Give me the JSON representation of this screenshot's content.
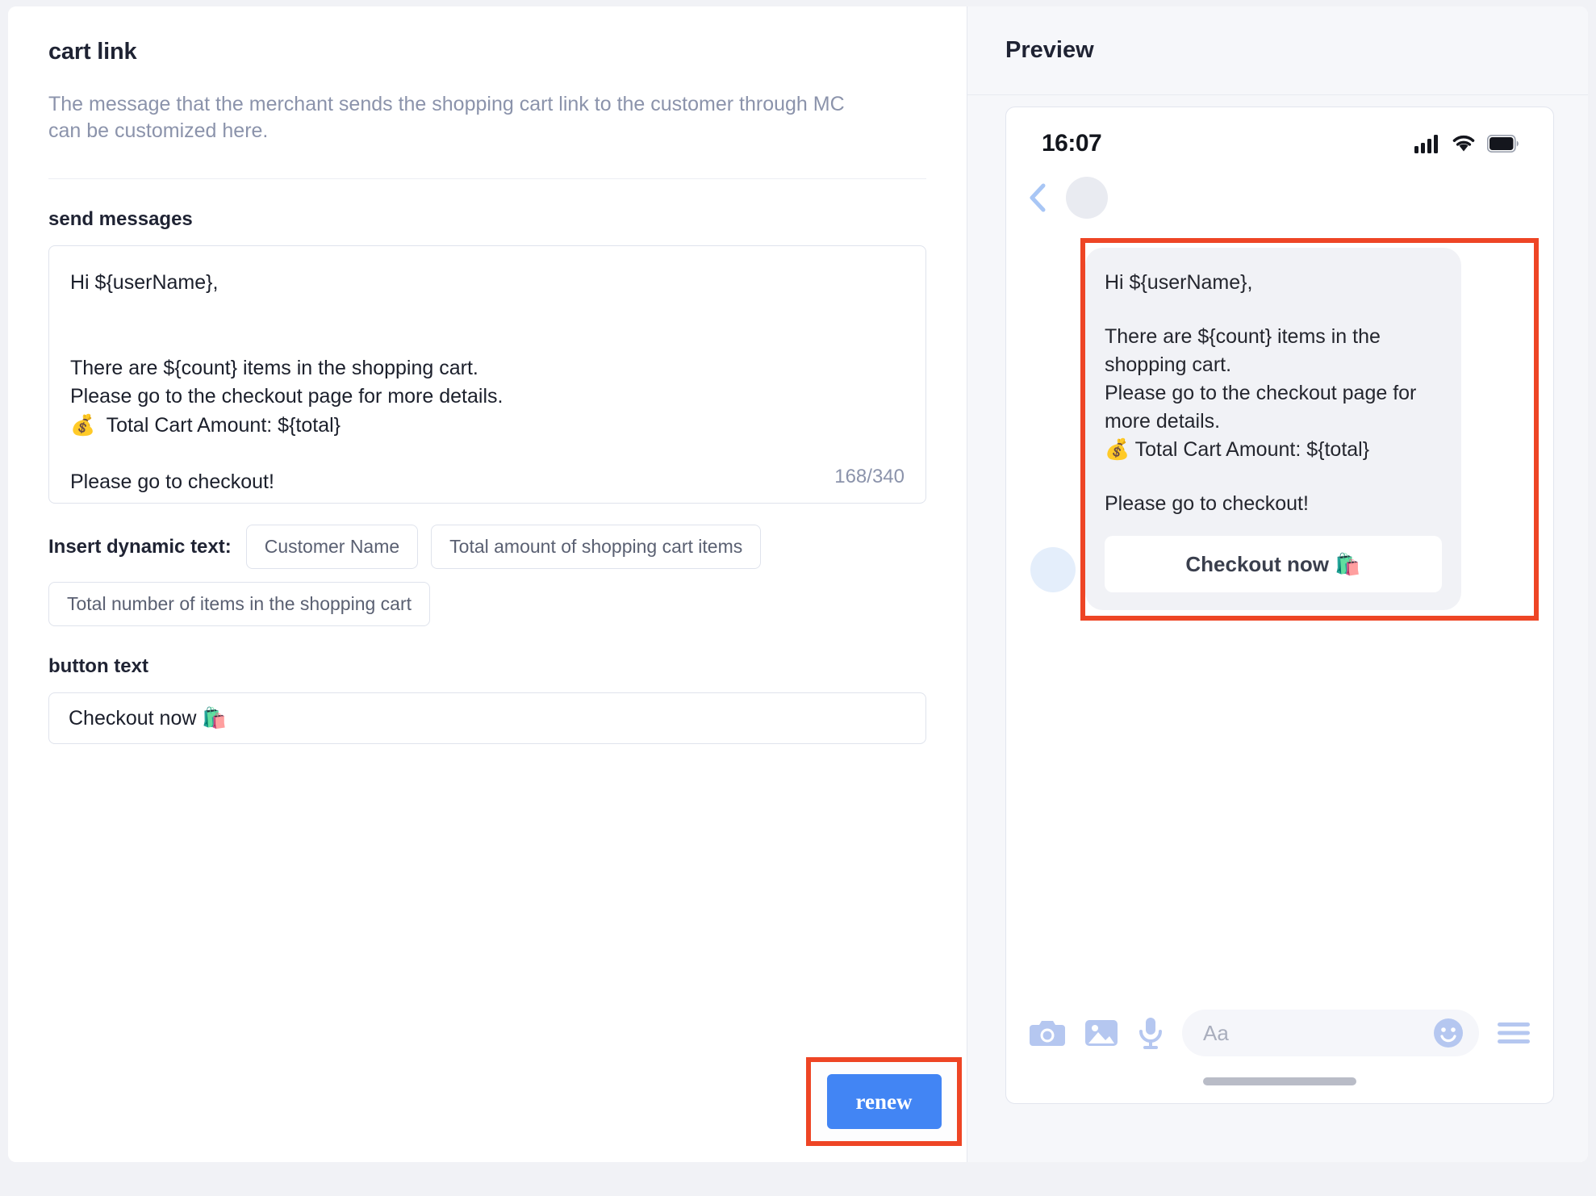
{
  "page": {
    "title": "cart link",
    "description": "The message that the merchant sends the shopping cart link to the customer through MC can be customized here."
  },
  "send_messages": {
    "label": "send messages",
    "lines": [
      "Hi ${userName},",
      "",
      "",
      "There are ${count} items in the shopping cart.",
      "Please go to the checkout page for more details.",
      "💰  Total Cart Amount: ${total}",
      "",
      "Please go to checkout!"
    ],
    "char_counter": "168/340"
  },
  "dynamic_text": {
    "label": "Insert dynamic text:",
    "chips": [
      "Customer Name",
      "Total amount of shopping cart items",
      "Total number of items in the shopping cart"
    ]
  },
  "button_text": {
    "label": "button text",
    "value": "Checkout now 🛍️"
  },
  "actions": {
    "renew_label": "renew"
  },
  "preview": {
    "title": "Preview",
    "phone": {
      "status_time": "16:07",
      "bubble_lines": [
        "Hi ${userName},",
        "",
        "There are ${count} items in the",
        "shopping cart.",
        "Please go to the checkout page for",
        "more details.",
        "💰  Total Cart Amount: ${total}",
        "",
        "Please go to checkout!"
      ],
      "cta_label": "Checkout now 🛍️",
      "composer_placeholder": "Aa"
    }
  },
  "colors": {
    "accent_blue": "#4285f4",
    "annotation_red": "#ee4525",
    "icon_blue": "#b5c7f0",
    "muted_text": "#8b93ab"
  }
}
